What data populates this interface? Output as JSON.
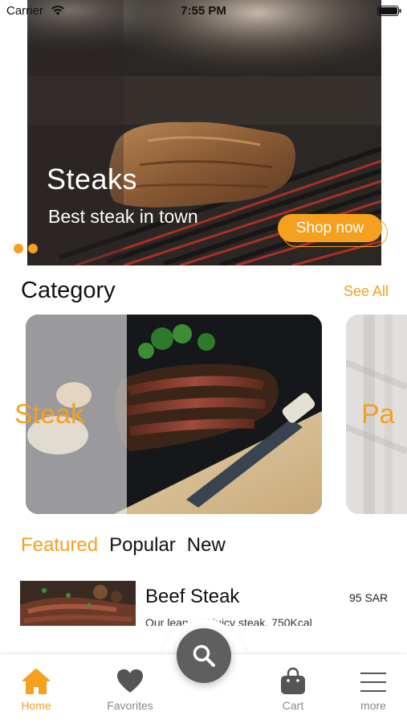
{
  "status_bar": {
    "carrier": "Carrier",
    "time": "7:55 PM"
  },
  "hero": {
    "title": "Steaks",
    "subtitle": "Best steak in town",
    "button_label": "Shop now",
    "dots": 2
  },
  "category": {
    "title": "Category",
    "see_all_label": "See All",
    "cards": [
      {
        "label": "Steak"
      },
      {
        "label": "Pa"
      }
    ]
  },
  "tabs": [
    {
      "label": "Featured",
      "active": true
    },
    {
      "label": "Popular",
      "active": false
    },
    {
      "label": "New",
      "active": false
    }
  ],
  "products": [
    {
      "name": "Beef Steak",
      "price": "95 SAR",
      "description": "Our lean, yet juicy steak, 750Kcal"
    }
  ],
  "tab_bar": {
    "items": [
      {
        "label": "Home",
        "icon": "home-icon",
        "active": true
      },
      {
        "label": "Favorites",
        "icon": "heart-icon",
        "active": false
      },
      {
        "label": "Cart",
        "icon": "bag-icon",
        "active": false
      },
      {
        "label": "more",
        "icon": "menu-icon",
        "active": false
      }
    ],
    "fab_icon": "search-icon"
  },
  "colors": {
    "accent": "#f5a01e",
    "fab": "#5f5f5f",
    "inactive": "#888888"
  }
}
